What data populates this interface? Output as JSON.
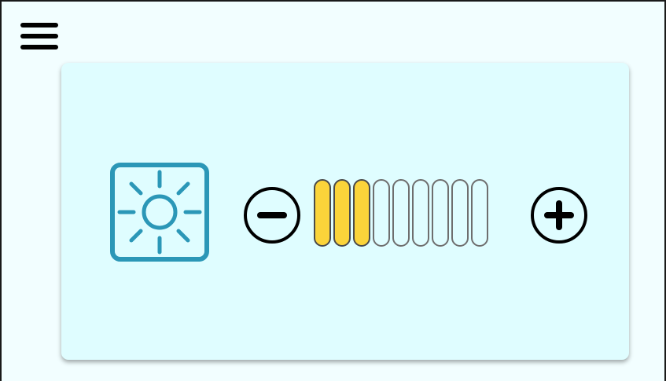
{
  "screen": {
    "menu_icon": "hamburger-menu-icon",
    "background_color": "#f2feff"
  },
  "brightness_panel": {
    "panel_color": "#dffdff",
    "setting_icon": "sun-icon",
    "icon_color": "#2b97b7",
    "decrease_icon": "minus-circle-icon",
    "increase_icon": "plus-circle-icon",
    "level": 3,
    "max_level": 9,
    "active_color": "#fbd43a"
  }
}
